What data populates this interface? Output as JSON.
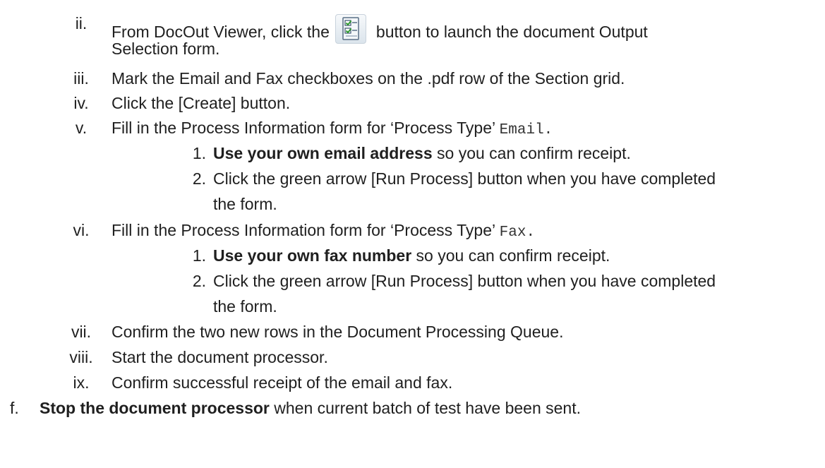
{
  "items": {
    "ii": {
      "num": "ii.",
      "text_a": "From DocOut Viewer, click the",
      "text_b": "button to launch the document Output",
      "text_c": "Selection form.",
      "icon": "output-selection-icon"
    },
    "iii": {
      "num": "iii.",
      "text": "Mark the Email and Fax checkboxes on the .pdf row of the Section grid."
    },
    "iv": {
      "num": "iv.",
      "text": "Click the [Create] button."
    },
    "v": {
      "num": "v.",
      "text": "Fill in the Process Information form for ‘Process Type’",
      "code": "Email."
    },
    "v1": {
      "num": "1.",
      "bold": "Use your own email address",
      "text": " so you can confirm receipt."
    },
    "v2": {
      "num": "2.",
      "text": "Click the green arrow [Run Process] button when you have completed",
      "text_cont": "the form."
    },
    "vi": {
      "num": "vi.",
      "text": "Fill in the Process Information form for ‘Process Type’",
      "code": "Fax."
    },
    "vi1": {
      "num": "1.",
      "bold": "Use your own fax number",
      "text": " so you can confirm receipt."
    },
    "vi2": {
      "num": "2.",
      "text": "Click the green arrow [Run Process] button when you have completed",
      "text_cont": "the form."
    },
    "vii": {
      "num": "vii.",
      "text": "Confirm the two new rows in the Document Processing Queue."
    },
    "viii": {
      "num": "viii.",
      "text": "Start the document processor."
    },
    "ix": {
      "num": "ix.",
      "text": "Confirm successful receipt of the email and fax."
    },
    "f": {
      "num": "f.",
      "bold": "Stop the document processor",
      "text": " when current batch of test have been sent."
    }
  }
}
